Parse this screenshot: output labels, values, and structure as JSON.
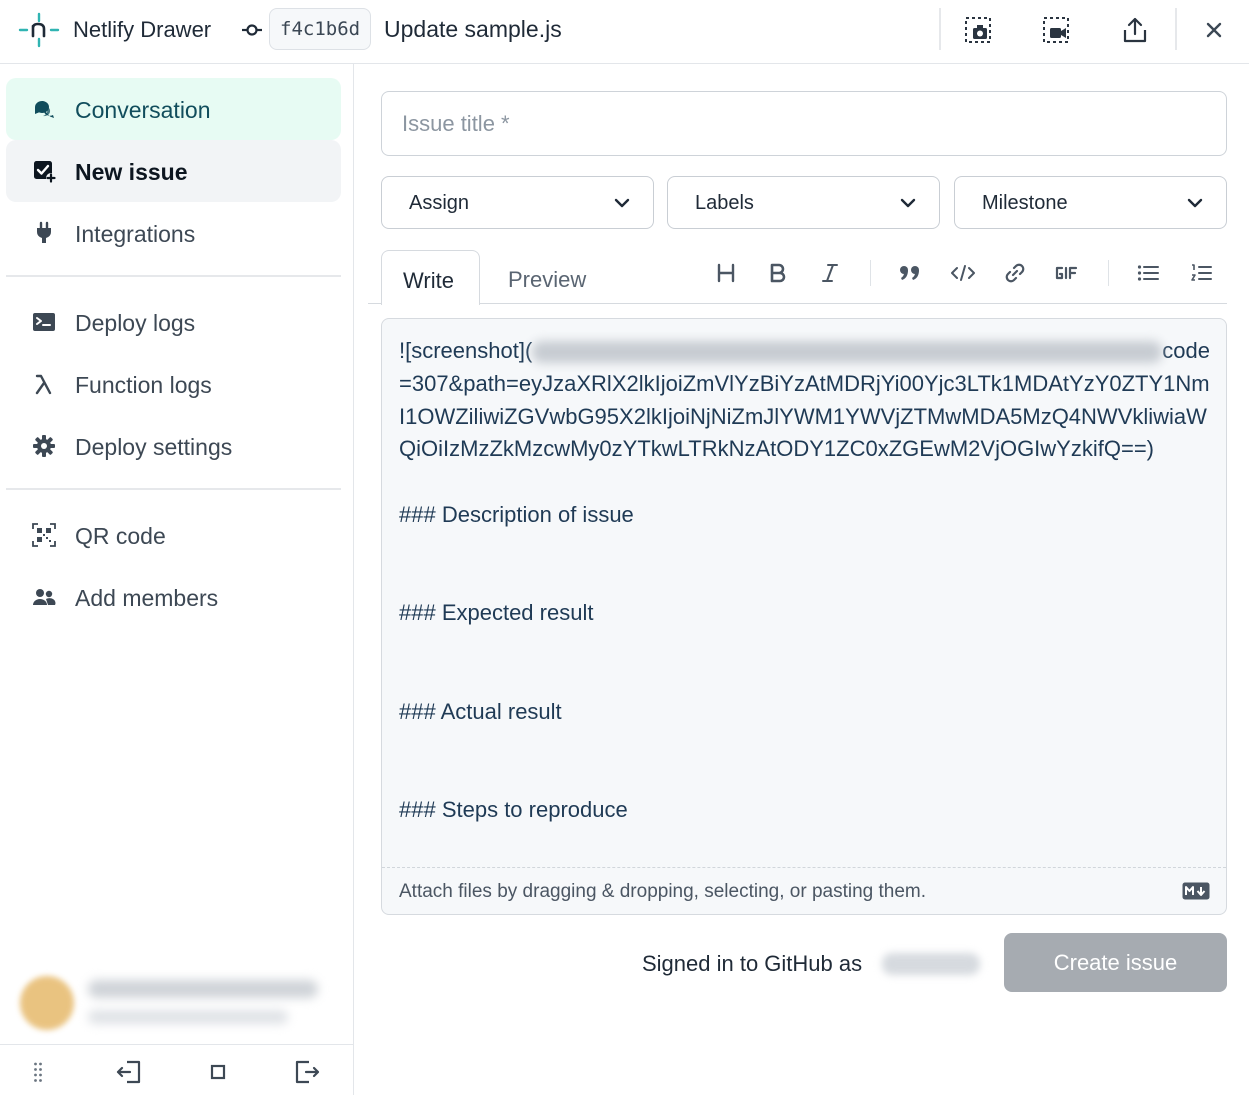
{
  "header": {
    "app_title": "Netlify Drawer",
    "commit_hash": "f4c1b6d",
    "commit_message": "Update sample.js",
    "actions": [
      {
        "name": "screenshot-button",
        "icon": "camera-capture-icon"
      },
      {
        "name": "record-video-button",
        "icon": "video-capture-icon"
      },
      {
        "name": "share-button",
        "icon": "share-upload-icon"
      },
      {
        "name": "close-button",
        "icon": "close-icon"
      }
    ]
  },
  "sidebar": {
    "items": [
      {
        "label": "Conversation",
        "icon": "chat-bubbles-icon",
        "state": "active"
      },
      {
        "label": "New issue",
        "icon": "new-issue-icon",
        "state": "selected"
      },
      {
        "label": "Integrations",
        "icon": "plug-icon"
      },
      {
        "label": "Deploy logs",
        "icon": "terminal-icon"
      },
      {
        "label": "Function logs",
        "icon": "lambda-icon"
      },
      {
        "label": "Deploy settings",
        "icon": "gear-icon"
      },
      {
        "label": "QR code",
        "icon": "qr-code-icon"
      },
      {
        "label": "Add members",
        "icon": "users-icon"
      }
    ],
    "bottom_controls": [
      "drag-handle-icon",
      "dock-left-icon",
      "float-window-icon",
      "dock-right-icon"
    ]
  },
  "issue_form": {
    "title_placeholder": "Issue title *",
    "title_value": "",
    "selects": [
      "Assign",
      "Labels",
      "Milestone"
    ],
    "tabs": {
      "write": "Write",
      "preview": "Preview",
      "active": "Write"
    },
    "toolbar": [
      "heading-icon",
      "bold-icon",
      "italic-icon",
      "quote-icon",
      "code-icon",
      "link-icon",
      "gif-icon",
      "bulleted-list-icon",
      "numbered-list-icon"
    ],
    "body": {
      "screenshot_prefix": "![screenshot](",
      "screenshot_query": "code=307&path=eyJzaXRlX2lkIjoiZmVlYzBiYzAtMDRjYi00Yjc3LTk1MDAtYzY0ZTY1NmI1OWZiliwiZGVwbG95X2lkIjoiNjNiZmJlYWM1YWVjZTMwMDA5MzQ4NWVkliwiaWQiOiIzMzZkMzcwMy0zYTkwLTRkNzAtODY1ZC0xZGEwM2VjOGIwYzkifQ==)",
      "section_description": "### Description of issue",
      "section_expected": "### Expected result",
      "section_actual": "### Actual result",
      "section_steps": "### Steps to reproduce"
    },
    "attach_hint": "Attach files by dragging & dropping, selecting, or pasting them.",
    "markdown_icon": "markdown-icon",
    "signed_in_text": "Signed in to GitHub as",
    "submit_label": "Create issue"
  },
  "colors": {
    "active_green_bg": "#e7fbf3",
    "selected_gray_bg": "#f2f4f6",
    "disabled_button": "#a6abb1",
    "brand_teal": "#30b4b2"
  }
}
